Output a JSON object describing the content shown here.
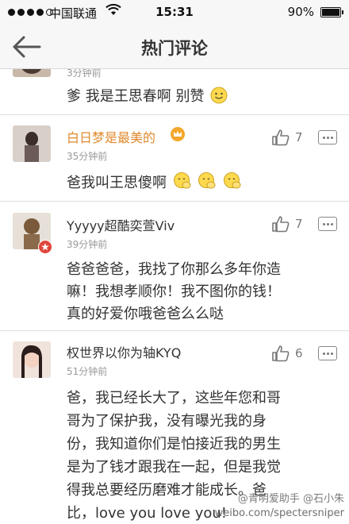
{
  "status_bar": {
    "carrier": "中国联通",
    "time": "15:31",
    "battery": "90%",
    "battery_level": 0.9
  },
  "nav": {
    "title": "热门评论",
    "back_icon": "back-arrow-icon"
  },
  "comments": [
    {
      "timestamp": "3分钟前",
      "text": "爹 我是王思春啊 别赞",
      "emoji_count": 1
    },
    {
      "username": "白日梦是最美的",
      "username_color": "#e08a2e",
      "badge": "crown-icon",
      "timestamp": "35分钟前",
      "likes": "7",
      "text": "爸我叫王思傻啊",
      "emoji_count": 3
    },
    {
      "username": "Yyyyy超酷奕萱Viv",
      "badge": "verified-badge-icon",
      "timestamp": "39分钟前",
      "likes": "7",
      "text_lines": [
        "爸爸爸爸，我找了你那么多年你造",
        "嘛！我想孝顺你！我不图你的钱！",
        "真的好爱你哦爸爸么么哒"
      ]
    },
    {
      "username": "权世界以你为轴KYQ",
      "timestamp": "51分钟前",
      "likes": "6",
      "text_lines": [
        "爸，我已经长大了，这些年您和哥",
        "哥为了保护我，没有曝光我的身",
        "份，我知道你们是怕接近我的男生",
        "是为了钱才跟我在一起，但是我觉",
        "得我总要经历磨难才能成长。爸",
        "比，love you love you!"
      ]
    }
  ],
  "watermark": {
    "line1": "@青明爱助手  @石小朱",
    "line2": "weibo.com/spectersniper"
  }
}
